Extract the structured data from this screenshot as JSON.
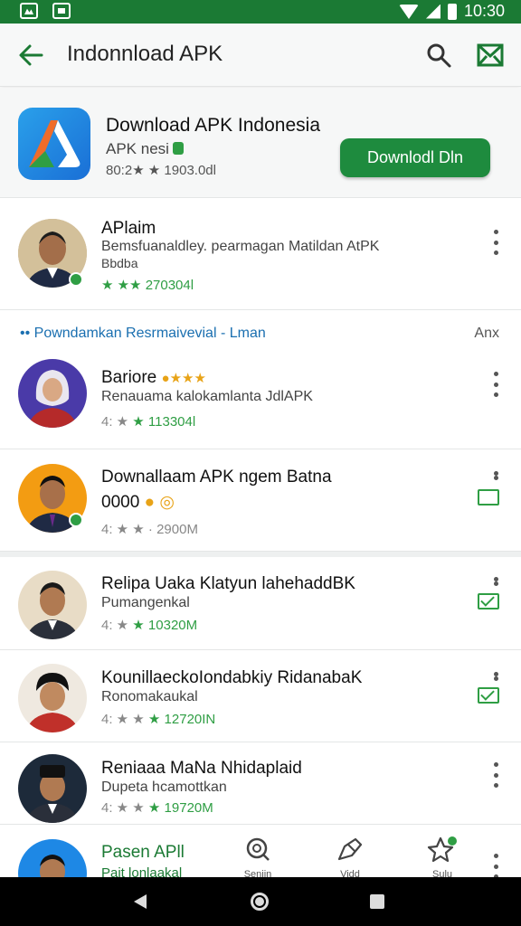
{
  "status_bar": {
    "time": "10:30"
  },
  "app_bar": {
    "title": "Indonnload APK"
  },
  "featured": {
    "title": "Download APK Indonesia",
    "subtitle": "APK nesi",
    "meta": "80:2★ ★ 1903.0dl",
    "button_label": "Downlodl Dln"
  },
  "top_item": {
    "title": "APlaim",
    "desc": "Bemsfuanaldley. pearmagan Matildan AtPK",
    "desc2": "Bbdba",
    "meta_prefix": "★ ★★",
    "meta_value": "270304l"
  },
  "section": {
    "title": "•• Powndamkan Resrmaivevial - Lman",
    "more": "Anx"
  },
  "items": [
    {
      "title": "Bariore",
      "desc": "Renauama kalokamlanta JdlAPK",
      "meta_prefix": "4: ★ ",
      "meta_value": "113304l"
    },
    {
      "title": "Downallaam APK ngem Batna",
      "desc": "0000",
      "meta_prefix": "4: ★ ★ · ",
      "meta_value": "2900M"
    },
    {
      "title": "Relipa Uaka Klatyun lahehaddBK",
      "desc": "Pumangenkal",
      "meta_prefix": "4: ★ ",
      "meta_value": "10320M"
    },
    {
      "title": "KounillaeckoIondabkiy RidanabaK",
      "desc": "Ronomakaukal",
      "meta_prefix": "4: ★ ★ ",
      "meta_value": "12720IN"
    },
    {
      "title": "Reniaaa MaNa Nhidaplaid",
      "desc": "Dupeta hcamottkan",
      "meta_prefix": "4: ★ ★ ",
      "meta_value": "19720M"
    }
  ],
  "bottom": {
    "title": "Pasen APll",
    "sub": "Pait lonlaakal",
    "nav": [
      {
        "label": "Seniin",
        "icon": "search-icon"
      },
      {
        "label": "Vidd",
        "icon": "share-icon"
      },
      {
        "label": "Sulu",
        "icon": "star-icon"
      }
    ]
  },
  "colors": {
    "brand": "#1b7a34",
    "accent": "#2f9e44",
    "link": "#1a6fb0"
  }
}
